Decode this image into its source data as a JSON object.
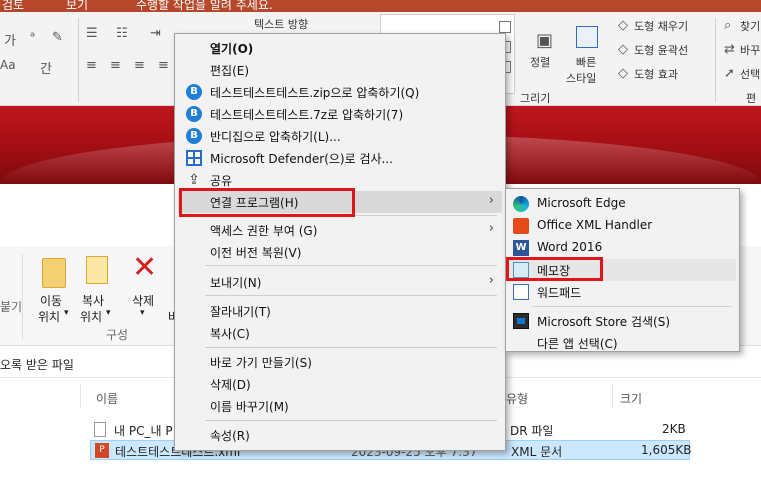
{
  "ppt": {
    "titlebar_left": "검토",
    "titlebar_mid": "보기",
    "titlebar_search": "수행할 작업을 알려 주세요.",
    "text_direction": "텍스트 방향",
    "arrange_label": "정렬",
    "quick_styles_label_1": "빠른",
    "quick_styles_label_2": "스타일",
    "shape_fill": "도형 채우기",
    "shape_outline": "도형 윤곽선",
    "shape_effects": "도형 효과",
    "drawing_group": "그리기",
    "find": "찾기",
    "replace": "바꾸기",
    "select": "선택",
    "edit_group": "편",
    "font_size_glyph": "가",
    "aa_glyph": "Aa",
    "underline_glyph": "간"
  },
  "explorer": {
    "move_to_1": "이동",
    "move_to_2": "위치",
    "copy_to_1": "복사",
    "copy_to_2": "위치",
    "delete_label": "삭제",
    "rename_partial": "바",
    "group_organize": "구성",
    "left_partial": "붙기",
    "address_text": "오록 받은 파일",
    "col_name": "이름",
    "col_type": "유형",
    "col_size": "크기",
    "rows": [
      {
        "name": "내 PC_내 P",
        "type": "DR 파일",
        "size": "2KB"
      },
      {
        "name": "테스트테스트테스트.xml",
        "type": "XML 문서",
        "size": "1,605KB",
        "date": "2023-09-25 오후 7:37"
      }
    ]
  },
  "context_menu": {
    "items": [
      {
        "label": "열기(O)"
      },
      {
        "label": "편집(E)"
      },
      {
        "label": "테스트테스트테스트.zip으로 압축하기(Q)",
        "icon": "bandizip-icon"
      },
      {
        "label": "테스트테스트테스트.7z로 압축하기(7)",
        "icon": "bandizip-icon"
      },
      {
        "label": "반디집으로 압축하기(L)...",
        "icon": "bandizip-icon"
      },
      {
        "label": "Microsoft Defender(으)로 검사...",
        "icon": "defender-icon"
      },
      {
        "label": "공유",
        "icon": "share-icon"
      },
      {
        "label": "연결 프로그램(H)"
      },
      {
        "label": "액세스 권한 부여 (G)"
      },
      {
        "label": "이전 버전 복원(V)"
      },
      {
        "label": "보내기(N)"
      },
      {
        "label": "잘라내기(T)"
      },
      {
        "label": "복사(C)"
      },
      {
        "label": "바로 가기 만들기(S)"
      },
      {
        "label": "삭제(D)"
      },
      {
        "label": "이름 바꾸기(M)"
      },
      {
        "label": "속성(R)"
      }
    ]
  },
  "open_with_submenu": {
    "items": [
      {
        "label": "Microsoft Edge",
        "icon": "edge-icon"
      },
      {
        "label": "Office XML Handler",
        "icon": "office-icon"
      },
      {
        "label": "Word 2016",
        "icon": "word-icon"
      },
      {
        "label": "메모장",
        "icon": "notepad-icon"
      },
      {
        "label": "워드패드",
        "icon": "wordpad-icon"
      },
      {
        "label": "Microsoft Store 검색(S)",
        "icon": "store-icon"
      },
      {
        "label": "다른 앱 선택(C)"
      }
    ]
  },
  "colors": {
    "highlight": "#e0141b",
    "ppt_accent": "#b7472a",
    "slide_red": "#c0161d",
    "selection": "#cce8ff"
  }
}
